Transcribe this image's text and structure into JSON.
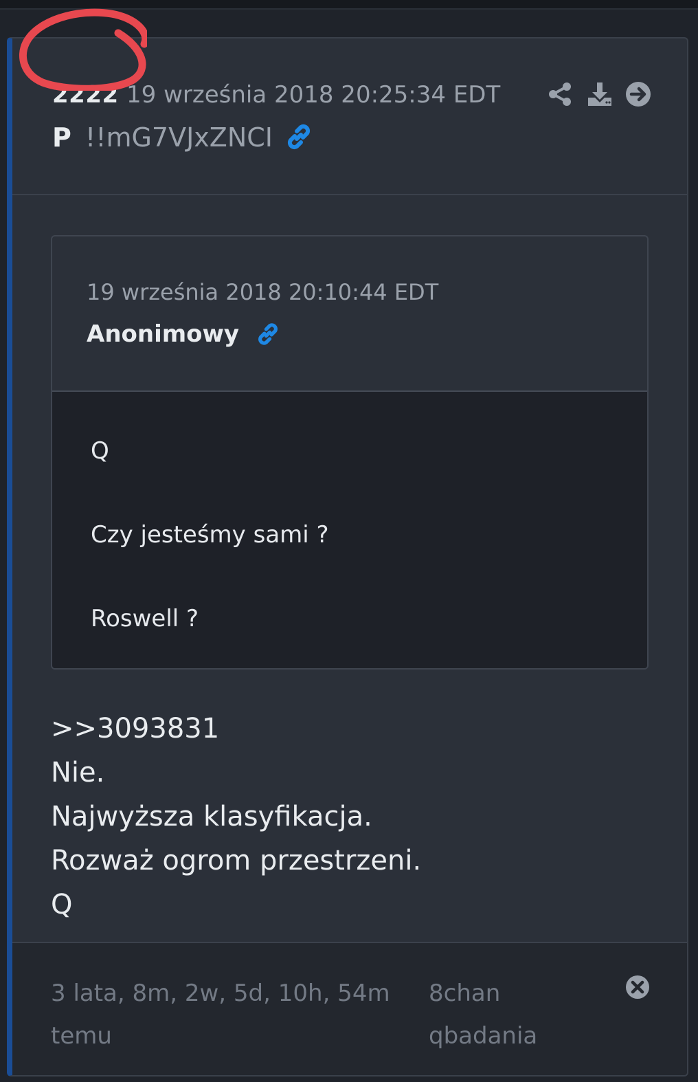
{
  "post": {
    "number": "2222",
    "date": "19 września 2018 20:25:34 EDT",
    "author": "P",
    "tripcode": "!!mG7VJxZNCI"
  },
  "quote": {
    "date": "19 września 2018 20:10:44 EDT",
    "author": "Anonimowy",
    "lines": [
      "Q",
      "Czy jesteśmy sami ?",
      "Roswell ?"
    ]
  },
  "message": {
    "lines": [
      ">>3093831",
      "Nie.",
      "Najwyższa klasyfikacja.",
      "Rozważ ogrom przestrzeni.",
      "Q"
    ]
  },
  "footer": {
    "age": "3 lata, 8m, 2w, 5d, 10h, 54m temu",
    "source": "8chan qbadania"
  },
  "icons": {
    "share": "share-icon",
    "download": "download-icon",
    "goto": "arrow-right-circle-icon",
    "link": "link-icon",
    "close": "close-circle-icon"
  },
  "colors": {
    "accent_border": "#1a4d96",
    "link_icon": "#1e88e5",
    "annotation_circle": "#e8484f"
  }
}
